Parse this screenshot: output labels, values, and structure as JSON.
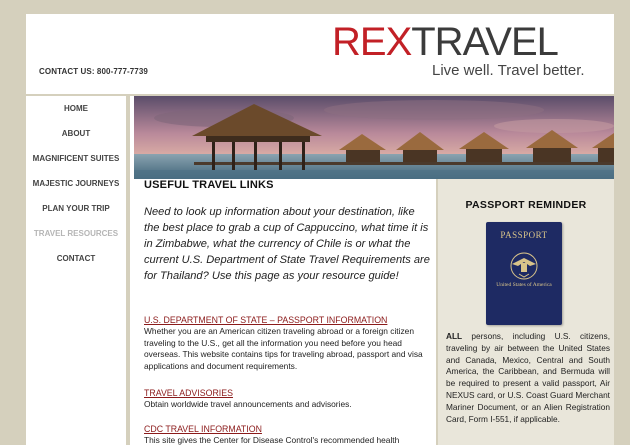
{
  "header": {
    "contact": "CONTACT US: 800-777-7739",
    "logo_rex": "REX",
    "logo_travel": "TRAVEL",
    "tagline": "Live well. Travel better."
  },
  "nav": {
    "items": [
      {
        "label": "HOME"
      },
      {
        "label": "ABOUT"
      },
      {
        "label": "MAGNIFICENT SUITES"
      },
      {
        "label": "MAJESTIC JOURNEYS"
      },
      {
        "label": "PLAN YOUR TRIP"
      },
      {
        "label": "TRAVEL RESOURCES"
      },
      {
        "label": "CONTACT"
      }
    ],
    "current_index": 5
  },
  "main": {
    "title": "USEFUL TRAVEL LINKS",
    "intro": "Need to look up information about your destination, like the best place to grab a cup of Cappuccino, what time it is in Zimbabwe, what the currency of Chile is or what the current U.S. Department of State Travel Requirements are for Thailand? Use this page as your resource guide!",
    "links": [
      {
        "title": "U.S. DEPARTMENT OF STATE – PASSPORT INFORMATION",
        "desc": "Whether you are an American citizen traveling abroad or a foreign citizen traveling to the U.S., get all the information you need before you head overseas. This website contains tips for traveling abroad, passport and visa applications and document requirements."
      },
      {
        "title": "TRAVEL ADVISORIES",
        "desc": "Obtain worldwide travel announcements and advisories."
      },
      {
        "title": "CDC TRAVEL INFORMATION",
        "desc": "This site gives the Center for Disease Control's recommended health precautions and warnings for travelers."
      }
    ]
  },
  "sidebar": {
    "title": "PASSPORT REMINDER",
    "passport_label": "PASSPORT",
    "passport_sub": "United States of America",
    "text_bold": "ALL",
    "text": " persons, including U.S. citizens, traveling by air between the United States and Canada, Mexico, Central and South America, the Caribbean, and Bermuda will be required to present a valid passport, Air NEXUS card, or U.S. Coast Guard Merchant Mariner Document, or an Alien Registration Card, Form I-551, if applicable."
  },
  "colors": {
    "brand_red": "#c22026",
    "link_red": "#8b1a1a",
    "frame": "#d5d0bd",
    "sidebar_bg": "#e9e6da",
    "passport_blue": "#1e2a63"
  }
}
